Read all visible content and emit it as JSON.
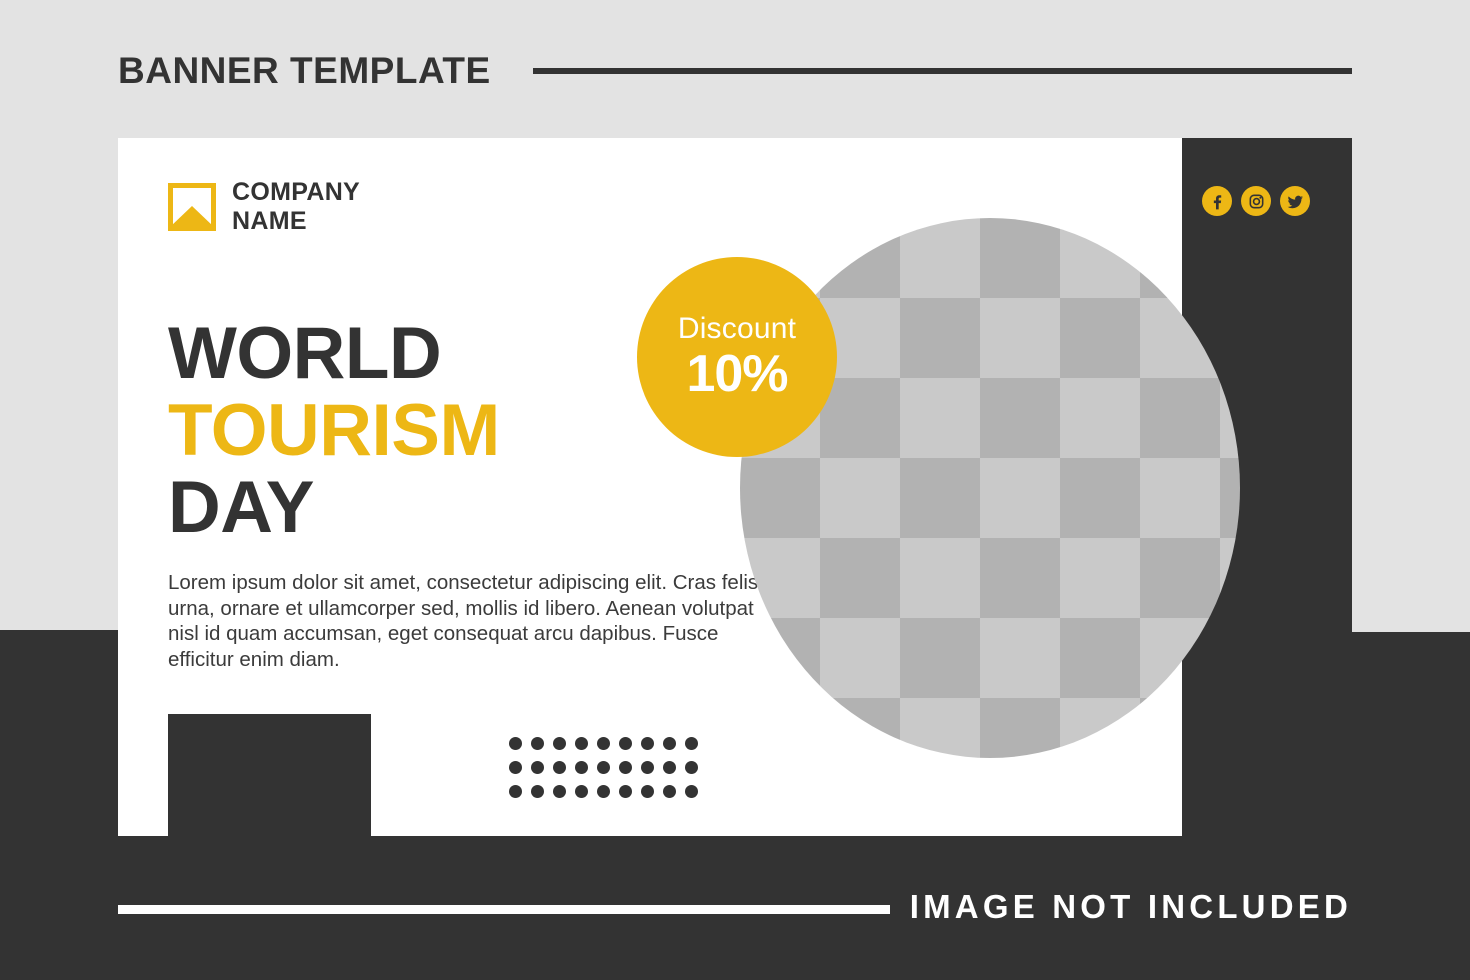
{
  "page": {
    "header_title": "BANNER TEMPLATE",
    "footer_note": "IMAGE NOT INCLUDED"
  },
  "colors": {
    "accent_yellow": "#edb715",
    "dark": "#333333",
    "page_background": "#e3e3e3",
    "card_background": "#ffffff",
    "checker_light": "#c9c9c9",
    "checker_dark": "#b2b2b2"
  },
  "banner": {
    "logo": {
      "icon": "image-placeholder-icon",
      "line1": "COMPANY",
      "line2": "NAME"
    },
    "social": [
      {
        "name": "facebook-icon",
        "label": "Facebook"
      },
      {
        "name": "instagram-icon",
        "label": "Instagram"
      },
      {
        "name": "twitter-icon",
        "label": "Twitter"
      }
    ],
    "headline": {
      "line1": "WORLD",
      "line2": "TOURISM",
      "line3": "DAY"
    },
    "body": "Lorem ipsum dolor sit amet, consectetur adipiscing elit. Cras felis urna, ornare et ullamcorper sed, mollis id libero. Aenean volutpat nisl id quam accumsan, eget consequat arcu dapibus. Fusce efficitur enim diam.",
    "discount": {
      "label": "Discount",
      "value": "10%"
    },
    "photo_placeholder": "checkerboard-circle",
    "dot_grid": {
      "columns": 9,
      "rows": 3
    }
  }
}
